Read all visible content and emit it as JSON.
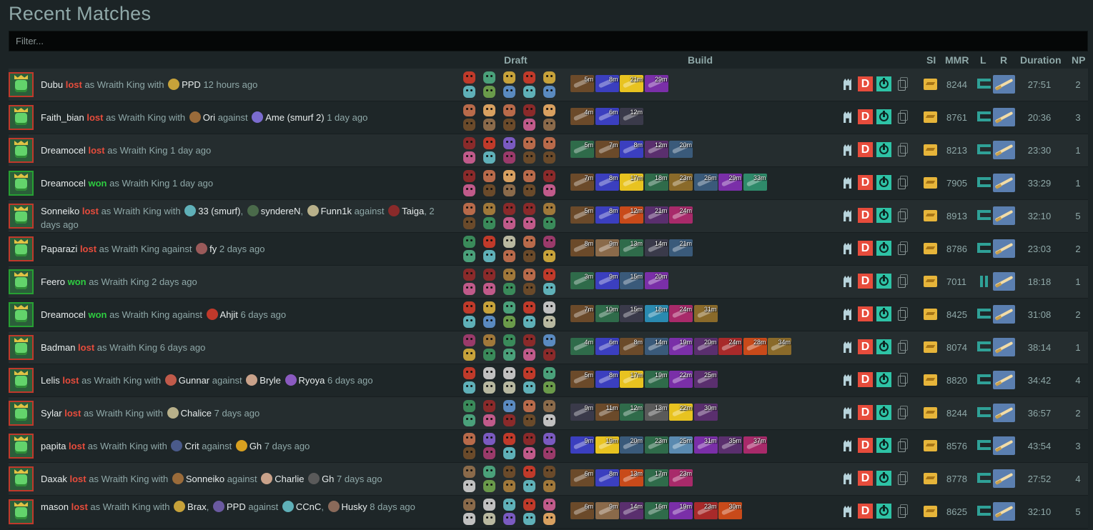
{
  "title": "Recent Matches",
  "filter": {
    "placeholder": "Filter..."
  },
  "headers": {
    "draft": "Draft",
    "build": "Build",
    "si": "SI",
    "mmr": "MMR",
    "l": "L",
    "r": "R",
    "duration": "Duration",
    "np": "NP"
  },
  "colors": {
    "won": "#2ecc40",
    "lost": "#e74c3c",
    "ally": "#ffffff",
    "text": "#8fa8a8"
  },
  "matches": [
    {
      "segments": [
        [
          "p",
          "Dubu"
        ],
        [
          "lost",
          "lost"
        ],
        [
          "t",
          " as Wraith King with "
        ],
        [
          "i",
          "#c7a23a"
        ],
        [
          "p",
          "PPD"
        ],
        [
          "t",
          " 12 hours ago"
        ]
      ],
      "items": [
        [
          "5m",
          "#6b4a2a"
        ],
        [
          "8m",
          "#3b3fbf"
        ],
        [
          "21m",
          "#e8c320"
        ],
        [
          "29m",
          "#7a2fa8"
        ]
      ],
      "mmr": "8244",
      "lane": "jungle",
      "duration": "27:51",
      "np": "2",
      "result": "lost"
    },
    {
      "segments": [
        [
          "p",
          "Faith_bian"
        ],
        [
          "lost",
          "lost"
        ],
        [
          "t",
          " as Wraith King with "
        ],
        [
          "i",
          "#9a6b3a"
        ],
        [
          "p",
          "Ori"
        ],
        [
          "t",
          " against "
        ],
        [
          "i",
          "#7b6ccf"
        ],
        [
          "p",
          "Ame (smurf 2)"
        ],
        [
          "t",
          " 1 day ago"
        ]
      ],
      "items": [
        [
          "4m",
          "#6b4a2a"
        ],
        [
          "6m",
          "#3b3fbf"
        ],
        [
          "12m",
          "#3a3a4a"
        ]
      ],
      "mmr": "8761",
      "lane": "jungle",
      "duration": "20:36",
      "np": "3",
      "result": "lost"
    },
    {
      "segments": [
        [
          "p",
          "Dreamocel"
        ],
        [
          "lost",
          "lost"
        ],
        [
          "t",
          " as Wraith King 1 day ago"
        ]
      ],
      "items": [
        [
          "5m",
          "#2f6b4a"
        ],
        [
          "7m",
          "#6b4a2a"
        ],
        [
          "8m",
          "#3b3fbf"
        ],
        [
          "12m",
          "#5a2f6e"
        ],
        [
          "20m",
          "#3a5a7a"
        ]
      ],
      "mmr": "8213",
      "lane": "jungle",
      "duration": "23:30",
      "np": "1",
      "result": "lost"
    },
    {
      "segments": [
        [
          "p",
          "Dreamocel"
        ],
        [
          "won",
          "won"
        ],
        [
          "t",
          " as Wraith King 1 day ago"
        ]
      ],
      "items": [
        [
          "7m",
          "#6b4a2a"
        ],
        [
          "8m",
          "#3b3fbf"
        ],
        [
          "17m",
          "#e8c320"
        ],
        [
          "18m",
          "#2f6b4a"
        ],
        [
          "23m",
          "#8a6a2a"
        ],
        [
          "26m",
          "#3a5a7a"
        ],
        [
          "29m",
          "#7a2fa8"
        ],
        [
          "33m",
          "#2f8a6a"
        ]
      ],
      "mmr": "7905",
      "lane": "jungle",
      "duration": "33:29",
      "np": "1",
      "result": "won"
    },
    {
      "segments": [
        [
          "p",
          "Sonneiko"
        ],
        [
          "lost",
          "lost"
        ],
        [
          "t",
          " as Wraith King with "
        ],
        [
          "i",
          "#5fb0b8"
        ],
        [
          "p",
          "33 (smurf)"
        ],
        [
          "t",
          ", "
        ],
        [
          "i",
          "#4a6a4a"
        ],
        [
          "p",
          "syndereN"
        ],
        [
          "t",
          ", "
        ],
        [
          "i",
          "#b8b08a"
        ],
        [
          "p",
          "Funn1k"
        ],
        [
          "t",
          " against "
        ],
        [
          "i",
          "#8a2a2a"
        ],
        [
          "p",
          "Taiga"
        ],
        [
          "t",
          ", 2 days ago"
        ]
      ],
      "items": [
        [
          "5m",
          "#6b4a2a"
        ],
        [
          "8m",
          "#3b3fbf"
        ],
        [
          "12m",
          "#c84a1a"
        ],
        [
          "21m",
          "#5a2f6e"
        ],
        [
          "24m",
          "#a82a6a"
        ]
      ],
      "mmr": "8913",
      "lane": "jungle",
      "duration": "32:10",
      "np": "5",
      "result": "lost"
    },
    {
      "segments": [
        [
          "p",
          "Paparazi"
        ],
        [
          "lost",
          "lost"
        ],
        [
          "t",
          " as Wraith King against "
        ],
        [
          "i",
          "#9a5a5a"
        ],
        [
          "p",
          "fy"
        ],
        [
          "t",
          " 2 days ago"
        ]
      ],
      "items": [
        [
          "8m",
          "#6b4a2a"
        ],
        [
          "9m",
          "#8a6a4a"
        ],
        [
          "13m",
          "#2f6b4a"
        ],
        [
          "14m",
          "#3a3a4a"
        ],
        [
          "21m",
          "#3a5a7a"
        ]
      ],
      "mmr": "8786",
      "lane": "jungle",
      "duration": "23:03",
      "np": "2",
      "result": "lost"
    },
    {
      "segments": [
        [
          "p",
          "Feero"
        ],
        [
          "won",
          "won"
        ],
        [
          "t",
          " as Wraith King 2 days ago"
        ]
      ],
      "items": [
        [
          "3m",
          "#2f6b4a"
        ],
        [
          "9m",
          "#3b3fbf"
        ],
        [
          "15m",
          "#3a5a7a"
        ],
        [
          "20m",
          "#7a2fa8"
        ]
      ],
      "mmr": "7011",
      "lane": "mid",
      "duration": "18:18",
      "np": "1",
      "result": "won"
    },
    {
      "segments": [
        [
          "p",
          "Dreamocel"
        ],
        [
          "won",
          "won"
        ],
        [
          "t",
          " as Wraith King against "
        ],
        [
          "i",
          "#c0392b"
        ],
        [
          "p",
          "Ahjit"
        ],
        [
          "t",
          " 6 days ago"
        ]
      ],
      "items": [
        [
          "7m",
          "#6b4a2a"
        ],
        [
          "10m",
          "#2f6b4a"
        ],
        [
          "15m",
          "#3a3a4a"
        ],
        [
          "18m",
          "#2a8ab0"
        ],
        [
          "24m",
          "#a82a6a"
        ],
        [
          "31m",
          "#8a6a2a"
        ]
      ],
      "mmr": "8425",
      "lane": "jungle",
      "duration": "31:08",
      "np": "2",
      "result": "won"
    },
    {
      "segments": [
        [
          "p",
          "Badman"
        ],
        [
          "lost",
          "lost"
        ],
        [
          "t",
          " as Wraith King 6 days ago"
        ]
      ],
      "items": [
        [
          "4m",
          "#2f6b4a"
        ],
        [
          "6m",
          "#3b3fbf"
        ],
        [
          "8m",
          "#6b4a2a"
        ],
        [
          "14m",
          "#3a5a7a"
        ],
        [
          "19m",
          "#7a2fa8"
        ],
        [
          "20m",
          "#5a2f6e"
        ],
        [
          "24m",
          "#a82a2a"
        ],
        [
          "28m",
          "#c84a1a"
        ],
        [
          "34m",
          "#8a6a2a"
        ]
      ],
      "mmr": "8074",
      "lane": "jungle",
      "duration": "38:14",
      "np": "1",
      "result": "lost"
    },
    {
      "segments": [
        [
          "p",
          "Lelis"
        ],
        [
          "lost",
          "lost"
        ],
        [
          "t",
          " as Wraith King with "
        ],
        [
          "i",
          "#c05a4a"
        ],
        [
          "p",
          "Gunnar"
        ],
        [
          "t",
          " against "
        ],
        [
          "i",
          "#c9a28a"
        ],
        [
          "p",
          "Bryle"
        ],
        [
          "t",
          " "
        ],
        [
          "i",
          "#8a5ac0"
        ],
        [
          "p",
          "Ryoya"
        ],
        [
          "t",
          " 6 days ago"
        ]
      ],
      "items": [
        [
          "5m",
          "#6b4a2a"
        ],
        [
          "8m",
          "#3b3fbf"
        ],
        [
          "17m",
          "#e8c320"
        ],
        [
          "19m",
          "#2f6b4a"
        ],
        [
          "22m",
          "#7a2fa8"
        ],
        [
          "25m",
          "#5a2f6e"
        ]
      ],
      "mmr": "8820",
      "lane": "jungle",
      "duration": "34:42",
      "np": "4",
      "result": "lost"
    },
    {
      "segments": [
        [
          "p",
          "Sylar"
        ],
        [
          "lost",
          "lost"
        ],
        [
          "t",
          " as Wraith King with "
        ],
        [
          "i",
          "#b8b08a"
        ],
        [
          "p",
          "Chalice"
        ],
        [
          "t",
          " 7 days ago"
        ]
      ],
      "items": [
        [
          "9m",
          "#3a3a4a"
        ],
        [
          "11m",
          "#6b4a2a"
        ],
        [
          "12m",
          "#2f6b4a"
        ],
        [
          "13m",
          "#5a5a5a"
        ],
        [
          "22m",
          "#e8c320"
        ],
        [
          "30m",
          "#5a2f6e"
        ]
      ],
      "mmr": "8244",
      "lane": "jungle",
      "duration": "36:57",
      "np": "2",
      "result": "lost"
    },
    {
      "segments": [
        [
          "p",
          "papita"
        ],
        [
          "lost",
          "lost"
        ],
        [
          "t",
          " as Wraith King with "
        ],
        [
          "i",
          "#4a5a8a"
        ],
        [
          "p",
          "Crit"
        ],
        [
          "t",
          " against "
        ],
        [
          "i",
          "#d8a020"
        ],
        [
          "p",
          "Gh"
        ],
        [
          "t",
          " 7 days ago"
        ]
      ],
      "items": [
        [
          "9m",
          "#3b3fbf"
        ],
        [
          "19m",
          "#e8c320"
        ],
        [
          "20m",
          "#3a5a7a"
        ],
        [
          "23m",
          "#2f6b4a"
        ],
        [
          "25m",
          "#5a8ab0"
        ],
        [
          "31m",
          "#7a2fa8"
        ],
        [
          "35m",
          "#5a2f6e"
        ],
        [
          "37m",
          "#a82a6a"
        ]
      ],
      "mmr": "8576",
      "lane": "jungle",
      "duration": "43:54",
      "np": "3",
      "result": "lost"
    },
    {
      "segments": [
        [
          "p",
          "Daxak"
        ],
        [
          "lost",
          "lost"
        ],
        [
          "t",
          " as Wraith King with "
        ],
        [
          "i",
          "#9a6b3a"
        ],
        [
          "p",
          "Sonneiko"
        ],
        [
          "t",
          " against "
        ],
        [
          "i",
          "#c9a28a"
        ],
        [
          "p",
          "Charlie"
        ],
        [
          "t",
          " "
        ],
        [
          "i",
          "#5a5a5a"
        ],
        [
          "p",
          "Gh"
        ],
        [
          "t",
          " 7 days ago"
        ]
      ],
      "items": [
        [
          "6m",
          "#6b4a2a"
        ],
        [
          "8m",
          "#3b3fbf"
        ],
        [
          "13m",
          "#c84a1a"
        ],
        [
          "17m",
          "#2f6b4a"
        ],
        [
          "23m",
          "#a82a6a"
        ]
      ],
      "mmr": "8778",
      "lane": "jungle",
      "duration": "27:52",
      "np": "4",
      "result": "lost"
    },
    {
      "segments": [
        [
          "p",
          "mason"
        ],
        [
          "lost",
          "lost"
        ],
        [
          "t",
          " as Wraith King with "
        ],
        [
          "i",
          "#c7a23a"
        ],
        [
          "p",
          "Brax"
        ],
        [
          "t",
          ", "
        ],
        [
          "i",
          "#6a5aa0"
        ],
        [
          "p",
          "PPD"
        ],
        [
          "t",
          " against "
        ],
        [
          "i",
          "#5fb0b8"
        ],
        [
          "p",
          "CCnC"
        ],
        [
          "t",
          ", "
        ],
        [
          "i",
          "#8a6a5a"
        ],
        [
          "p",
          "Husky"
        ],
        [
          "t",
          " 8 days ago"
        ]
      ],
      "items": [
        [
          "6m",
          "#6b4a2a"
        ],
        [
          "9m",
          "#8a6a4a"
        ],
        [
          "14m",
          "#5a2f6e"
        ],
        [
          "16m",
          "#2f6b4a"
        ],
        [
          "19m",
          "#7a2fa8"
        ],
        [
          "23m",
          "#a82a2a"
        ],
        [
          "30m",
          "#c84a1a"
        ]
      ],
      "mmr": "8625",
      "lane": "jungle",
      "duration": "32:10",
      "np": "5",
      "result": "lost"
    }
  ],
  "draft_palette": [
    "#8a6a4a",
    "#c7a23a",
    "#6a9a4a",
    "#b86a4a",
    "#c05a8a",
    "#7a5ac0",
    "#3a8a5a",
    "#c0c0c0",
    "#5a8ac0",
    "#c03a2a",
    "#6a4a2a",
    "#d8a060",
    "#9a3a6a",
    "#4aa07a",
    "#b8b8a0",
    "#8a2a2a",
    "#5fb0b8",
    "#a0783a"
  ],
  "draft_seeds": [
    3,
    7,
    11,
    5,
    13,
    2,
    17,
    9,
    4,
    15,
    8,
    1,
    12,
    6
  ]
}
